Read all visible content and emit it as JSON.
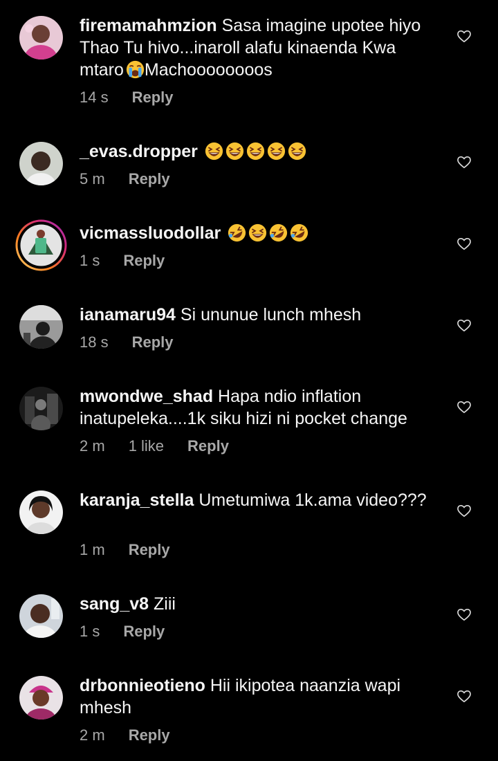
{
  "colors": {
    "background": "#000000",
    "text": "#f5f5f5",
    "muted": "#a8a8a8",
    "story_ring": "#d62976"
  },
  "like_icon": "heart-outline-icon",
  "comments": [
    {
      "username": "firemamahmzion",
      "text_lines": [
        "Sasa imagine upotee",
        "hiyo Thao Tu hivo...inaroll alafu kinaenda",
        "Kwa mtaro",
        "Machoooooooos"
      ],
      "emoji": [
        "loudly-crying-face"
      ],
      "time": "14 s",
      "likes": "",
      "reply_label": "Reply"
    },
    {
      "username": "_evas.dropper",
      "text": "",
      "emoji": [
        "grinning-squinting-face",
        "grinning-squinting-face",
        "grinning-squinting-face",
        "grinning-squinting-face",
        "grinning-squinting-face"
      ],
      "time": "5 m",
      "likes": "",
      "reply_label": "Reply"
    },
    {
      "username": "vicmassluodollar",
      "text": "",
      "emoji": [
        "rolling-on-floor-laughing",
        "grinning-squinting-face",
        "rolling-on-floor-laughing",
        "rolling-on-floor-laughing"
      ],
      "story_ring": true,
      "time": "1 s",
      "likes": "",
      "reply_label": "Reply"
    },
    {
      "username": "ianamaru94",
      "text": "Si ununue lunch mhesh",
      "time": "18 s",
      "likes": "",
      "reply_label": "Reply"
    },
    {
      "username": "mwondwe_shad",
      "text_lines": [
        "Hapa ndio inflation",
        "inatupeleka....1k siku hizi ni pocket change"
      ],
      "time": "2 m",
      "likes": "1 like",
      "reply_label": "Reply"
    },
    {
      "username": "karanja_stella",
      "text_lines": [
        "Umetumiwa 1k.ama",
        "video???"
      ],
      "time": "1 m",
      "likes": "",
      "reply_label": "Reply"
    },
    {
      "username": "sang_v8",
      "text": "Ziii",
      "time": "1 s",
      "likes": "",
      "reply_label": "Reply"
    },
    {
      "username": "drbonnieotieno",
      "text_lines": [
        "Hii ikipotea naanzia wapi",
        "mhesh"
      ],
      "time": "2 m",
      "likes": "",
      "reply_label": "Reply"
    }
  ]
}
